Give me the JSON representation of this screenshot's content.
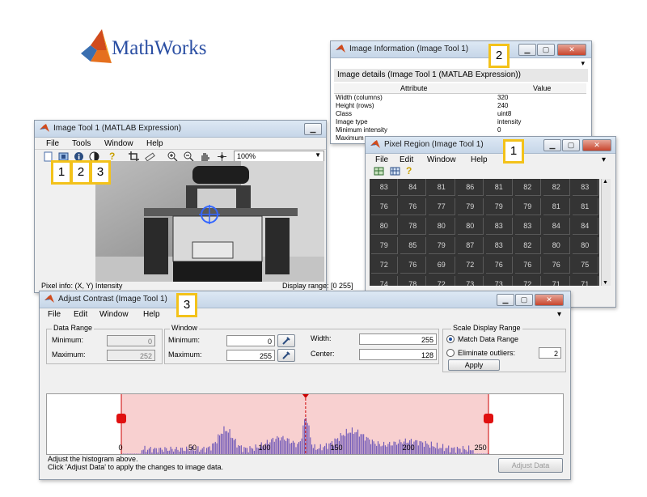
{
  "brand": {
    "name": "MathWorks",
    "color": "#2b4fa3",
    "logo_colors": [
      "#d14b1d",
      "#f5a41a"
    ]
  },
  "image_tool": {
    "title": "Image Tool 1   (MATLAB Expression)",
    "menu": [
      "File",
      "Tools",
      "Window",
      "Help"
    ],
    "zoom": "100%",
    "pixel_info": "Pixel info: (X, Y)  Intensity",
    "display_range": "Display range: [0 255]",
    "callouts": [
      "1",
      "2",
      "3"
    ],
    "toolbar_icons": [
      "new-figure-icon",
      "pixel-region-icon",
      "image-info-icon",
      "adjust-contrast-icon",
      "help-icon",
      "crop-icon",
      "measure-distance-icon",
      "zoom-in-icon",
      "zoom-out-icon",
      "pan-icon",
      "overview-icon"
    ]
  },
  "image_info": {
    "title": "Image Information (Image Tool 1)",
    "callout": "2",
    "details_header": "Image details  (Image Tool 1   (MATLAB Expression))",
    "columns": [
      "Attribute",
      "Value"
    ],
    "rows": [
      {
        "attr": "Width (columns)",
        "value": "320"
      },
      {
        "attr": "Height (rows)",
        "value": "240"
      },
      {
        "attr": "Class",
        "value": "uint8"
      },
      {
        "attr": "Image type",
        "value": "intensity"
      },
      {
        "attr": "Minimum intensity",
        "value": "0"
      },
      {
        "attr": "Maximum",
        "value": ""
      }
    ]
  },
  "pixel_region": {
    "title": "Pixel Region (Image Tool 1)",
    "callout": "1",
    "menu": [
      "File",
      "Edit",
      "Window",
      "Help"
    ],
    "grid": [
      [
        "83",
        "84",
        "81",
        "86",
        "81",
        "82",
        "82",
        "83"
      ],
      [
        "76",
        "76",
        "77",
        "79",
        "79",
        "79",
        "81",
        "81"
      ],
      [
        "80",
        "78",
        "80",
        "80",
        "83",
        "83",
        "84",
        "84"
      ],
      [
        "79",
        "85",
        "79",
        "87",
        "83",
        "82",
        "80",
        "80"
      ],
      [
        "72",
        "76",
        "69",
        "72",
        "76",
        "76",
        "76",
        "75"
      ],
      [
        "74",
        "78",
        "72",
        "73",
        "73",
        "72",
        "71",
        "71"
      ]
    ]
  },
  "adjust_contrast": {
    "title": "Adjust Contrast (Image Tool 1)",
    "callout": "3",
    "menu": [
      "File",
      "Edit",
      "Window",
      "Help"
    ],
    "data_range": {
      "title": "Data Range",
      "min_label": "Minimum:",
      "min": "0",
      "max_label": "Maximum:",
      "max": "252"
    },
    "window": {
      "title": "Window",
      "min_label": "Minimum:",
      "min": "0",
      "max_label": "Maximum:",
      "max": "255",
      "width_label": "Width:",
      "width": "255",
      "center_label": "Center:",
      "center": "128"
    },
    "scale": {
      "title": "Scale Display Range",
      "match_label": "Match Data Range",
      "eliminate_label": "Eliminate outliers:",
      "eliminate_value": "2",
      "apply_label": "Apply"
    },
    "axis_ticks": [
      "0",
      "50",
      "100",
      "150",
      "200",
      "250"
    ],
    "status_line1": "Adjust the histogram above.",
    "status_line2": "Click 'Adjust Data' to apply the changes to image data.",
    "adjust_button": "Adjust Data"
  }
}
